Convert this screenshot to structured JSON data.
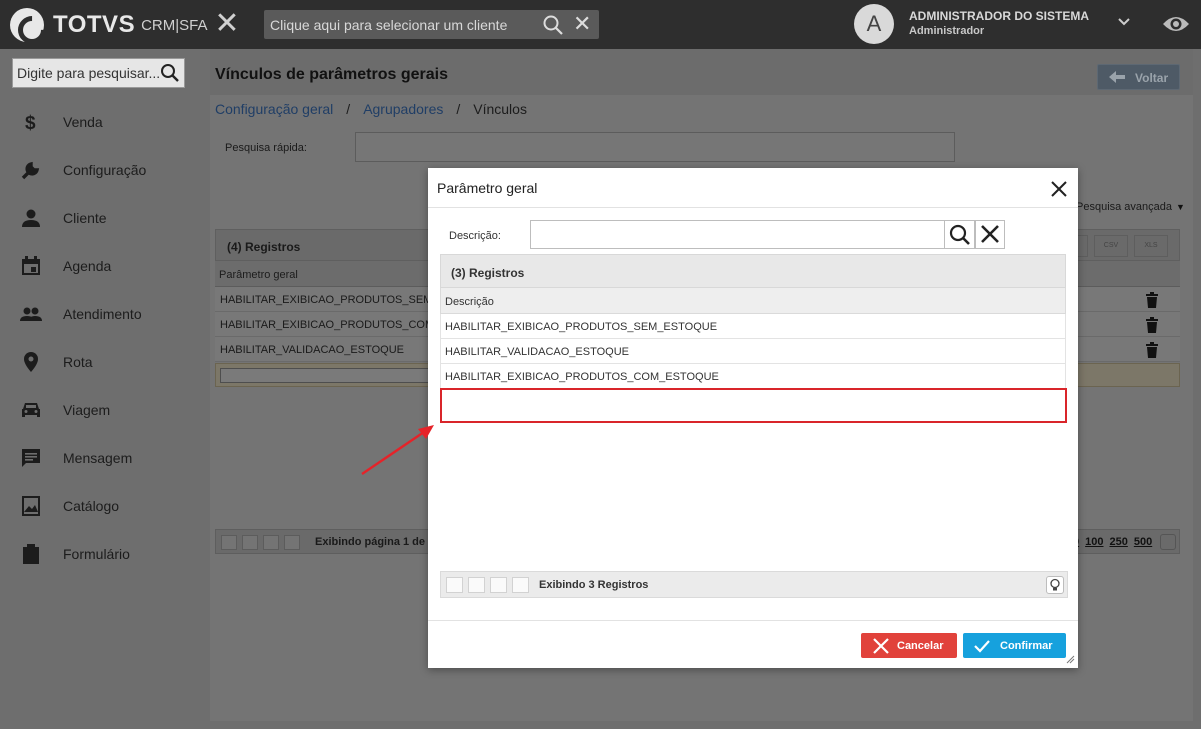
{
  "topbar": {
    "brand": "TOTVS",
    "brand_sub": "CRM|SFA",
    "client_placeholder": "Clique aqui para selecionar um cliente",
    "avatar_letter": "A",
    "user_name": "ADMINISTRADOR DO SISTEMA",
    "user_role": "Administrador"
  },
  "sidebar": {
    "search_placeholder": "Digite para pesquisar...",
    "items": [
      {
        "label": "Venda",
        "icon": "dollar-icon"
      },
      {
        "label": "Configuração",
        "icon": "wrench-icon"
      },
      {
        "label": "Cliente",
        "icon": "person-icon"
      },
      {
        "label": "Agenda",
        "icon": "calendar-icon"
      },
      {
        "label": "Atendimento",
        "icon": "people-icon"
      },
      {
        "label": "Rota",
        "icon": "location-pin-icon"
      },
      {
        "label": "Viagem",
        "icon": "car-icon"
      },
      {
        "label": "Mensagem",
        "icon": "message-icon"
      },
      {
        "label": "Catálogo",
        "icon": "image-icon"
      },
      {
        "label": "Formulário",
        "icon": "clipboard-icon"
      }
    ]
  },
  "page": {
    "title": "Vínculos de parâmetros gerais",
    "back_label": "Voltar",
    "breadcrumb": [
      "Configuração geral",
      "Agrupadores",
      "Vínculos"
    ],
    "quick_search_label": "Pesquisa rápida:",
    "advanced_search": "Pesquisa avançada",
    "grid_title": "(4) Registros",
    "grid_column": "Parâmetro geral",
    "rows": [
      "HABILITAR_EXIBICAO_PRODUTOS_SEM_E",
      "HABILITAR_EXIBICAO_PRODUTOS_COM_E",
      "HABILITAR_VALIDACAO_ESTOQUE"
    ],
    "export_csv": "CSV",
    "export_xls": "XLS",
    "pager_text": "Exibindo página 1 de",
    "page_sizes": [
      "0",
      "100",
      "250",
      "500"
    ]
  },
  "modal": {
    "title": "Parâmetro geral",
    "description_label": "Descrição:",
    "description_value": "",
    "grid_title": "(3) Registros",
    "column": "Descrição",
    "rows": [
      "HABILITAR_EXIBICAO_PRODUTOS_SEM_ESTOQUE",
      "HABILITAR_VALIDACAO_ESTOQUE",
      "HABILITAR_EXIBICAO_PRODUTOS_COM_ESTOQUE"
    ],
    "pager_text": "Exibindo 3 Registros",
    "cancel_label": "Cancelar",
    "confirm_label": "Confirmar"
  },
  "colors": {
    "topbar": "#2e2e2e",
    "cancel": "#e1423b",
    "confirm": "#16a1dd",
    "highlight": "#d9252a"
  }
}
